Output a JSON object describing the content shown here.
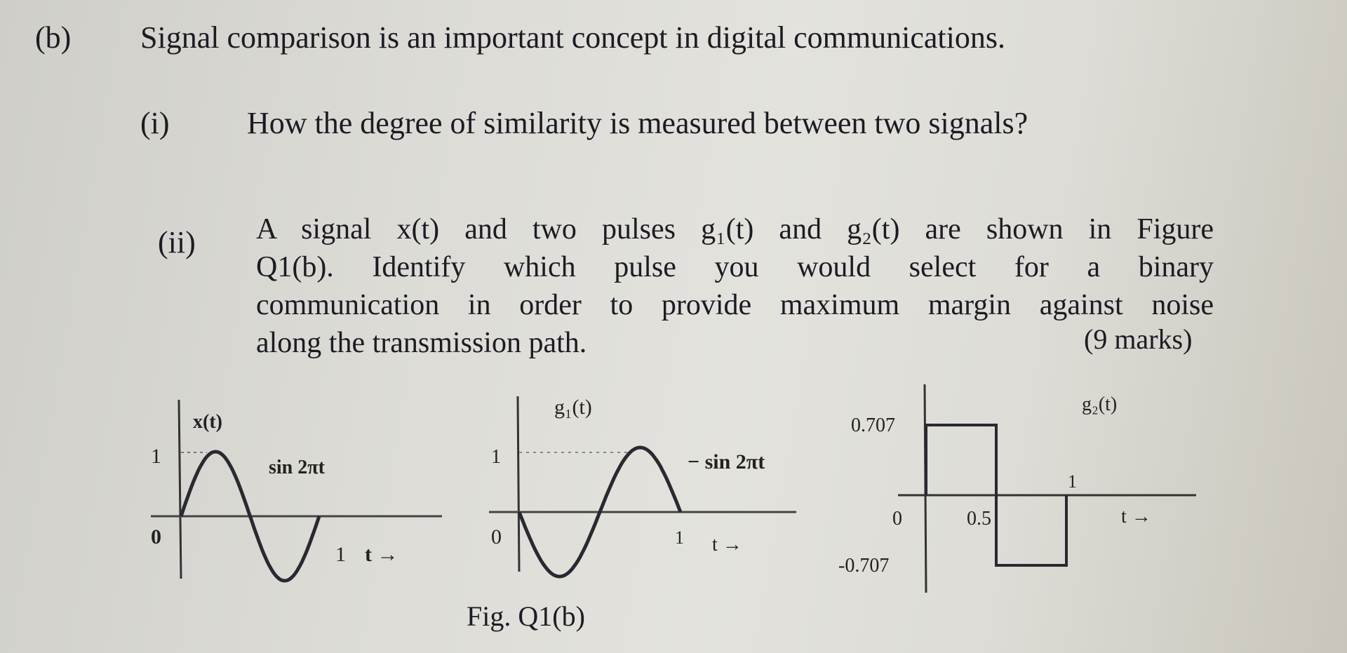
{
  "question": {
    "label": "(b)",
    "text": "Signal comparison is an important concept in digital communications.",
    "parts": [
      {
        "label": "(i)",
        "text": "How the degree of similarity is measured between two signals?"
      },
      {
        "label": "(ii)",
        "lines": [
          "A signal x(t) and two pulses g₁(t) and g₂(t) are shown in Figure",
          "Q1(b). Identify which pulse you would select for a binary",
          "communication in order to provide maximum margin against noise",
          "along the transmission path."
        ],
        "marks": "(9 marks)"
      }
    ]
  },
  "figure": {
    "caption": "Fig. Q1(b)"
  },
  "chart_data": [
    {
      "type": "line",
      "title": "x(t)",
      "annotation": "sin 2πt",
      "xlabel": "t →",
      "x_ticks": [
        "0",
        "1"
      ],
      "y_ticks": [
        "1"
      ],
      "xlim": [
        0,
        1
      ],
      "ylim": [
        -1,
        1
      ],
      "function": "sin(2*pi*t)",
      "x": [
        0,
        0.125,
        0.25,
        0.375,
        0.5,
        0.625,
        0.75,
        0.875,
        1
      ],
      "y": [
        0,
        0.707,
        1,
        0.707,
        0,
        -0.707,
        -1,
        -0.707,
        0
      ]
    },
    {
      "type": "line",
      "title": "g₁(t)",
      "annotation": "− sin 2πt",
      "xlabel": "t →",
      "x_ticks": [
        "0",
        "1"
      ],
      "y_ticks": [
        "1"
      ],
      "xlim": [
        0,
        1
      ],
      "ylim": [
        -1,
        1
      ],
      "function": "-sin(2*pi*t)",
      "x": [
        0,
        0.125,
        0.25,
        0.375,
        0.5,
        0.625,
        0.75,
        0.875,
        1
      ],
      "y": [
        0,
        -0.707,
        -1,
        -0.707,
        0,
        0.707,
        1,
        0.707,
        0
      ]
    },
    {
      "type": "line",
      "title": "g₂(t)",
      "xlabel": "t →",
      "x_ticks": [
        "0",
        "0.5",
        "1"
      ],
      "y_ticks": [
        "0.707",
        "-0.707"
      ],
      "xlim": [
        0,
        1
      ],
      "ylim": [
        -0.707,
        0.707
      ],
      "x": [
        0,
        0,
        0.5,
        0.5,
        1,
        1
      ],
      "y": [
        0,
        0.707,
        0.707,
        -0.707,
        -0.707,
        0
      ]
    }
  ]
}
